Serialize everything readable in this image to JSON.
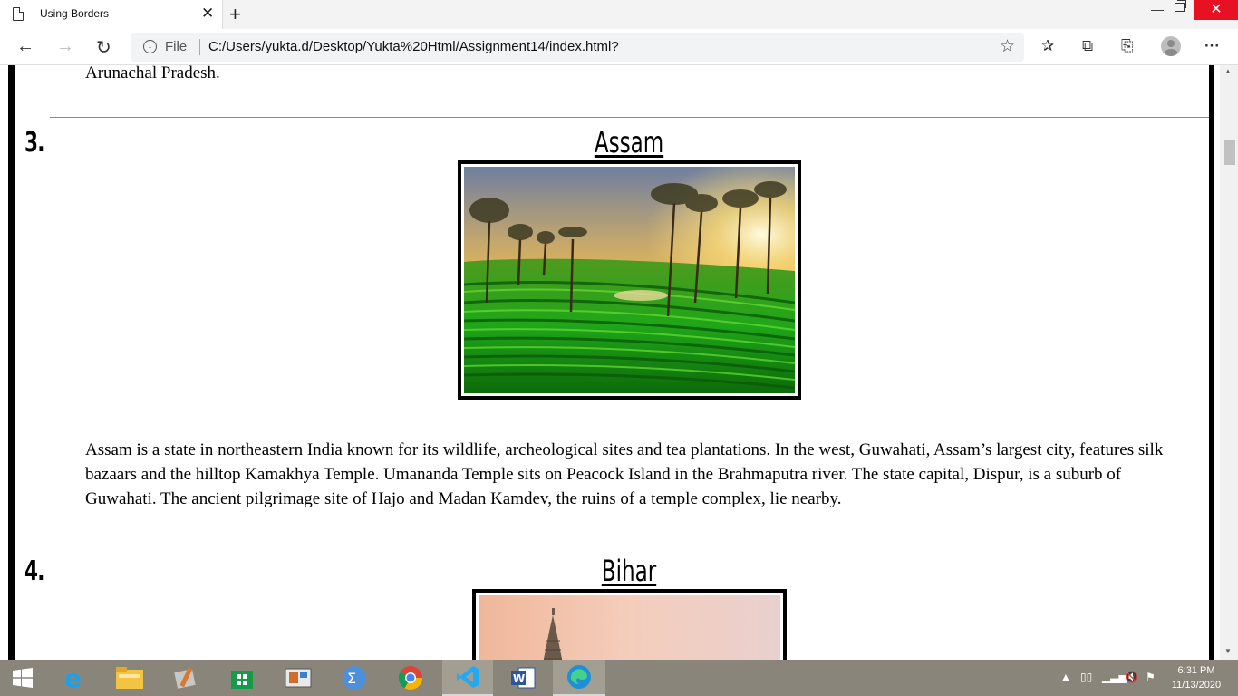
{
  "browser": {
    "tab_title": "Using Borders",
    "tab_close": "✕",
    "new_tab": "+",
    "file_label": "File",
    "url": "C:/Users/yukta.d/Desktop/Yukta%20Html/Assignment14/index.html?"
  },
  "page": {
    "prev_tail": "Arunachal Pradesh.",
    "sections": [
      {
        "number": "3.",
        "title": "Assam",
        "description": "Assam is a state in northeastern India known for its wildlife, archeological sites and tea plantations. In the west, Guwahati, Assam’s largest city, features silk bazaars and the hilltop Kamakhya Temple. Umananda Temple sits on Peacock Island in the Brahmaputra river. The state capital, Dispur, is a suburb of Guwahati. The ancient pilgrimage site of Hajo and Madan Kamdev, the ruins of a temple complex, lie nearby."
      },
      {
        "number": "4.",
        "title": "Bihar"
      }
    ]
  },
  "taskbar": {
    "time": "6:31 PM",
    "date": "11/13/2020"
  },
  "colors": {
    "page_frame": "#000000",
    "taskbar": "#8a857a",
    "close_button": "#e81123"
  }
}
